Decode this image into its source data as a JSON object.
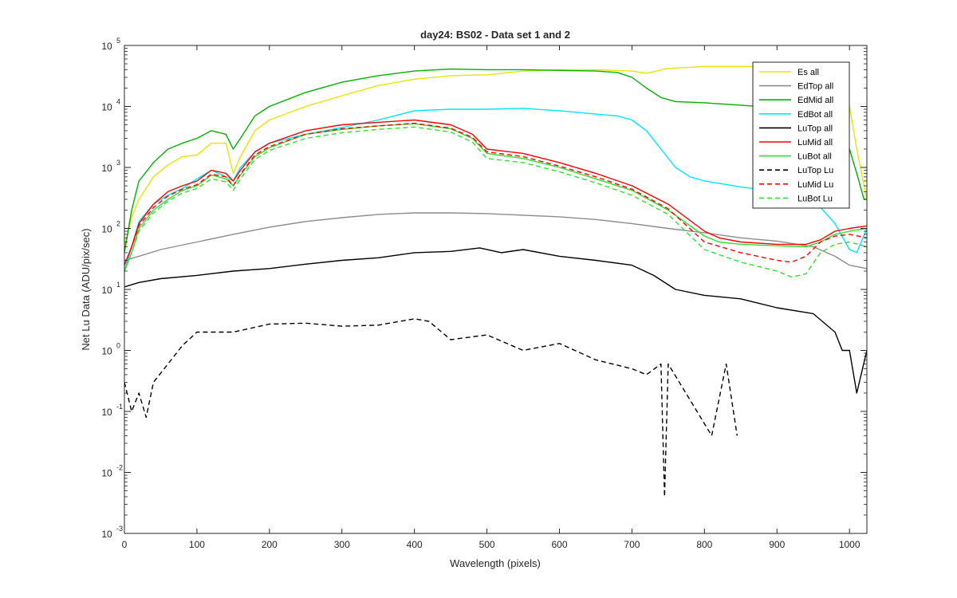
{
  "chart_data": {
    "type": "line",
    "title": "day24: BS02 - Data set 1 and 2",
    "xlabel": "Wavelength (pixels)",
    "ylabel": "Net Lu Data (ADU/pix/sec)",
    "xlim": [
      0,
      1024
    ],
    "ylim": [
      0.001,
      100000
    ],
    "yscale": "log",
    "grid": false,
    "legend_location": "top-right",
    "x_ticks": [
      0,
      100,
      200,
      300,
      400,
      500,
      600,
      700,
      800,
      900,
      1000
    ],
    "x_tick_labels": [
      "0",
      "100",
      "200",
      "300",
      "400",
      "500",
      "600",
      "700",
      "800",
      "900",
      "1000"
    ],
    "y_ticks": [
      0.001,
      0.01,
      0.1,
      1,
      10,
      100,
      1000,
      10000,
      100000
    ],
    "y_tick_labels": [
      {
        "base": "10",
        "exp": "-3"
      },
      {
        "base": "10",
        "exp": "-2"
      },
      {
        "base": "10",
        "exp": "-1"
      },
      {
        "base": "10",
        "exp": "0"
      },
      {
        "base": "10",
        "exp": "1"
      },
      {
        "base": "10",
        "exp": "2"
      },
      {
        "base": "10",
        "exp": "3"
      },
      {
        "base": "10",
        "exp": "4"
      },
      {
        "base": "10",
        "exp": "5"
      }
    ],
    "series": [
      {
        "name": "Es  all",
        "color": "#e6e600",
        "dash": "solid",
        "x": [
          0,
          10,
          20,
          40,
          60,
          80,
          100,
          120,
          140,
          150,
          160,
          180,
          200,
          250,
          300,
          350,
          400,
          450,
          500,
          550,
          600,
          650,
          700,
          720,
          750,
          800,
          850,
          900,
          960,
          980,
          1000,
          1010,
          1024
        ],
        "y": [
          50,
          150,
          300,
          700,
          1100,
          1500,
          1600,
          2500,
          2500,
          800,
          1500,
          4000,
          6000,
          10000,
          15000,
          22000,
          28000,
          32000,
          33000,
          38000,
          40000,
          40000,
          38000,
          35000,
          42000,
          45000,
          45000,
          45000,
          45000,
          40000,
          10000,
          2000,
          300
        ]
      },
      {
        "name": "EdTop  all",
        "color": "#8c8c8c",
        "dash": "solid",
        "x": [
          0,
          20,
          50,
          100,
          150,
          200,
          250,
          300,
          350,
          400,
          450,
          500,
          550,
          600,
          650,
          700,
          750,
          800,
          850,
          900,
          950,
          980,
          1000,
          1024
        ],
        "y": [
          30,
          35,
          45,
          60,
          80,
          105,
          130,
          150,
          170,
          180,
          180,
          175,
          165,
          155,
          140,
          120,
          100,
          85,
          70,
          62,
          50,
          35,
          25,
          22
        ]
      },
      {
        "name": "EdMid  all",
        "color": "#00b000",
        "dash": "solid",
        "x": [
          0,
          10,
          20,
          40,
          60,
          80,
          100,
          120,
          140,
          150,
          160,
          180,
          200,
          250,
          300,
          350,
          400,
          450,
          500,
          550,
          600,
          650,
          680,
          700,
          720,
          740,
          760,
          800,
          850,
          900,
          950,
          1000,
          1010,
          1020,
          1024
        ],
        "y": [
          40,
          200,
          600,
          1200,
          2000,
          2500,
          3000,
          4000,
          3500,
          2000,
          3000,
          7000,
          10000,
          17000,
          25000,
          32000,
          38000,
          41000,
          40000,
          40000,
          39000,
          38000,
          36000,
          30000,
          20000,
          14000,
          12000,
          11500,
          10500,
          9500,
          8000,
          2000,
          800,
          300,
          300
        ]
      },
      {
        "name": "EdBot  all",
        "color": "#00e5ff",
        "dash": "solid",
        "x": [
          0,
          10,
          20,
          40,
          60,
          80,
          100,
          120,
          140,
          150,
          160,
          180,
          200,
          250,
          300,
          350,
          400,
          450,
          500,
          550,
          600,
          650,
          680,
          700,
          720,
          740,
          760,
          780,
          800,
          820,
          850,
          900,
          950,
          980,
          1000,
          1010,
          1024
        ],
        "y": [
          20,
          50,
          130,
          250,
          350,
          450,
          650,
          900,
          700,
          600,
          1000,
          1800,
          2500,
          3500,
          4500,
          6000,
          8500,
          9000,
          9000,
          9300,
          8500,
          7500,
          7000,
          6000,
          4000,
          2000,
          1000,
          700,
          600,
          550,
          480,
          400,
          300,
          120,
          45,
          40,
          100
        ]
      },
      {
        "name": "LuTop  all",
        "color": "#000000",
        "dash": "solid",
        "x": [
          0,
          20,
          50,
          100,
          150,
          200,
          250,
          300,
          350,
          400,
          450,
          490,
          520,
          550,
          600,
          650,
          700,
          730,
          760,
          800,
          850,
          900,
          950,
          980,
          990,
          1000,
          1010,
          1024
        ],
        "y": [
          11,
          13,
          15,
          17,
          20,
          22,
          26,
          30,
          33,
          40,
          42,
          48,
          40,
          45,
          35,
          30,
          25,
          17,
          10,
          8,
          7,
          5,
          4,
          2,
          1,
          1,
          0.2,
          1
        ]
      },
      {
        "name": "LuMid  all",
        "color": "#ff0000",
        "dash": "solid",
        "x": [
          0,
          10,
          20,
          40,
          60,
          80,
          100,
          120,
          140,
          150,
          160,
          180,
          200,
          250,
          300,
          350,
          400,
          450,
          480,
          500,
          550,
          600,
          650,
          700,
          750,
          800,
          820,
          850,
          900,
          940,
          960,
          980,
          1000,
          1024
        ],
        "y": [
          25,
          50,
          120,
          250,
          400,
          500,
          600,
          900,
          800,
          600,
          900,
          1800,
          2500,
          4000,
          5000,
          5500,
          6000,
          5000,
          3500,
          2000,
          1700,
          1200,
          800,
          500,
          250,
          90,
          70,
          60,
          55,
          55,
          65,
          90,
          100,
          110
        ]
      },
      {
        "name": "LuBot  all",
        "color": "#33dd33",
        "dash": "solid",
        "x": [
          0,
          10,
          20,
          40,
          60,
          80,
          100,
          120,
          140,
          150,
          160,
          180,
          200,
          250,
          300,
          350,
          400,
          450,
          480,
          500,
          550,
          600,
          650,
          700,
          750,
          800,
          820,
          850,
          900,
          940,
          960,
          980,
          1000,
          1024
        ],
        "y": [
          20,
          40,
          100,
          200,
          300,
          420,
          500,
          750,
          650,
          500,
          750,
          1500,
          2100,
          3500,
          4200,
          4800,
          5200,
          4300,
          3000,
          1700,
          1400,
          1000,
          650,
          420,
          200,
          75,
          60,
          55,
          52,
          50,
          60,
          80,
          90,
          100
        ]
      },
      {
        "name": "LuTop  Lu",
        "color": "#000000",
        "dash": "dashed",
        "x": [
          0,
          10,
          20,
          30,
          40,
          60,
          80,
          100,
          150,
          200,
          250,
          300,
          350,
          400,
          420,
          450,
          500,
          550,
          600,
          650,
          700,
          720,
          740,
          745,
          750,
          810,
          830,
          845
        ],
        "y": [
          0.3,
          0.1,
          0.2,
          0.08,
          0.3,
          0.6,
          1.2,
          2.0,
          2.0,
          2.7,
          2.8,
          2.5,
          2.6,
          3.3,
          3.0,
          1.5,
          1.8,
          1.0,
          1.3,
          0.7,
          0.5,
          0.4,
          0.6,
          0.004,
          0.6,
          0.04,
          0.6,
          0.04
        ]
      },
      {
        "name": "LuMid  Lu",
        "color": "#ff0000",
        "dash": "dashed",
        "x": [
          0,
          10,
          20,
          40,
          60,
          80,
          100,
          120,
          140,
          150,
          160,
          180,
          200,
          250,
          300,
          350,
          400,
          450,
          480,
          500,
          550,
          600,
          650,
          700,
          750,
          800,
          850,
          900,
          920,
          940,
          960,
          980,
          1000,
          1024
        ],
        "y": [
          25,
          50,
          110,
          220,
          340,
          440,
          520,
          780,
          700,
          500,
          780,
          1600,
          2200,
          3500,
          4300,
          4800,
          5300,
          4400,
          3100,
          1800,
          1500,
          1050,
          700,
          440,
          210,
          60,
          40,
          30,
          28,
          35,
          60,
          75,
          80,
          70
        ]
      },
      {
        "name": "LuBot  Lu",
        "color": "#33dd33",
        "dash": "dashed",
        "x": [
          0,
          10,
          20,
          40,
          60,
          80,
          100,
          120,
          140,
          150,
          160,
          180,
          200,
          250,
          300,
          350,
          400,
          450,
          480,
          500,
          550,
          600,
          650,
          700,
          750,
          800,
          850,
          900,
          920,
          940,
          960,
          980,
          1000,
          1024
        ],
        "y": [
          20,
          40,
          90,
          180,
          280,
          380,
          450,
          650,
          580,
          420,
          650,
          1350,
          1900,
          3000,
          3700,
          4200,
          4600,
          3800,
          2600,
          1400,
          1200,
          850,
          560,
          350,
          170,
          45,
          28,
          20,
          16,
          18,
          40,
          55,
          60,
          50
        ]
      }
    ]
  }
}
